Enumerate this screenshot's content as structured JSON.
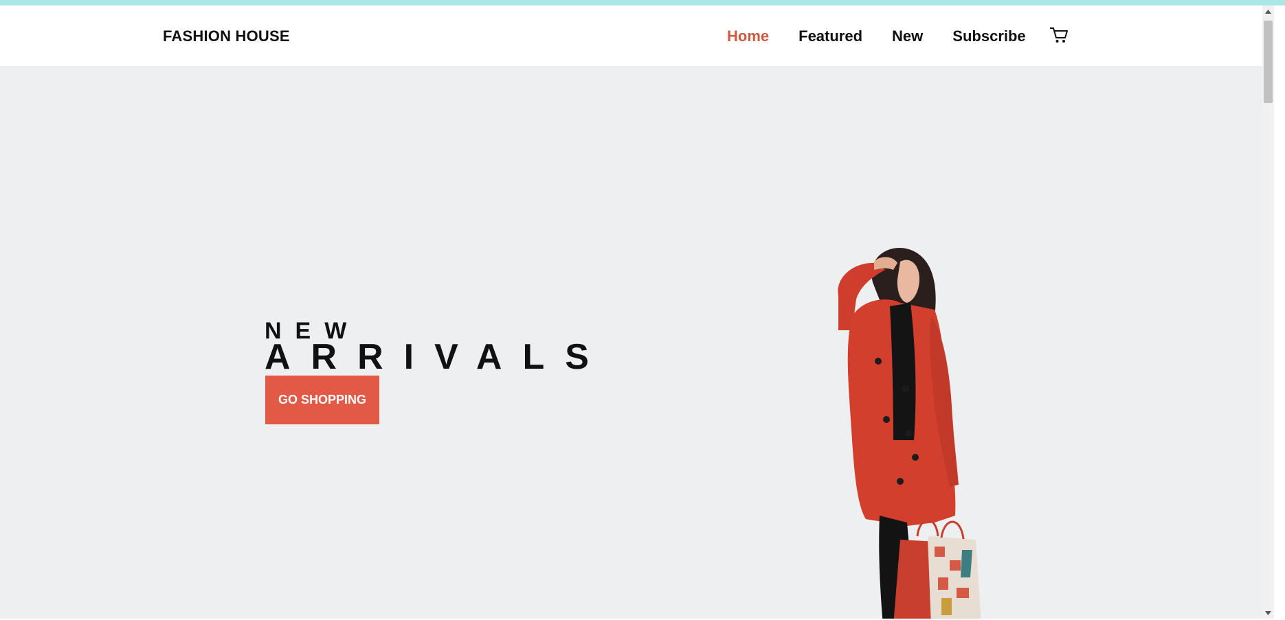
{
  "brand": "FASHION HOUSE",
  "nav": {
    "items": [
      {
        "label": "Home",
        "active": true
      },
      {
        "label": "Featured",
        "active": false
      },
      {
        "label": "New",
        "active": false
      },
      {
        "label": "Subscribe",
        "active": false
      }
    ],
    "cart_icon": "cart-icon"
  },
  "hero": {
    "eyebrow": "NEW",
    "headline": "ARRIVALS",
    "cta_label": "GO SHOPPING",
    "image": "model-in-red-coat-with-shopping-bags"
  },
  "colors": {
    "accent": "#e25a45",
    "active_nav": "#cf5a42",
    "hero_bg": "#eeeff1",
    "top_strip": "#a8e8e6"
  }
}
